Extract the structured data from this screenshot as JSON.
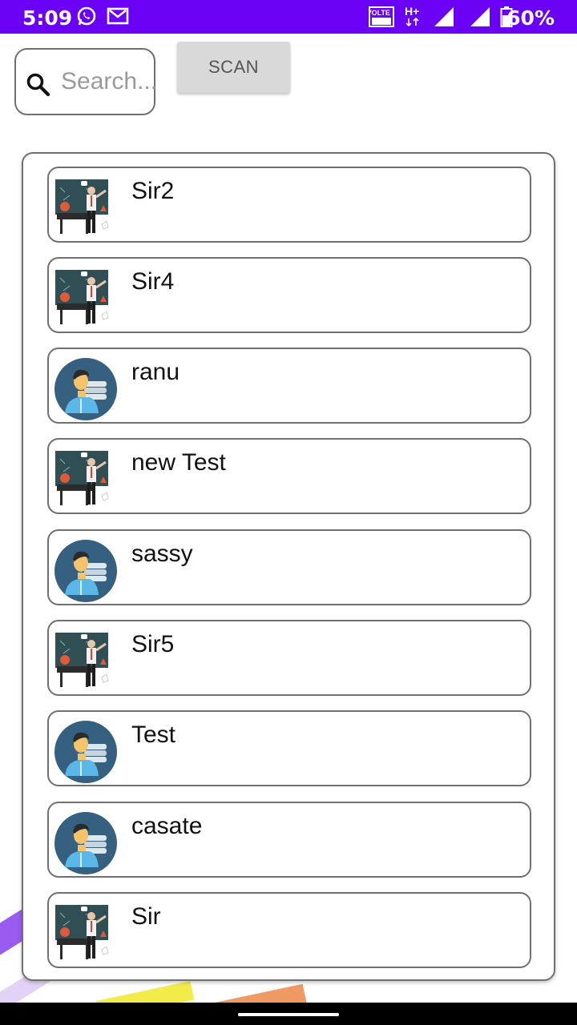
{
  "status_bar": {
    "time": "5:09",
    "battery": "60%",
    "network": "VOLTE 2",
    "data_type": "H+",
    "icons": [
      "whatsapp-icon",
      "gmail-icon",
      "volte-icon",
      "hplus-icon",
      "signal-icon",
      "signal-icon",
      "battery-icon"
    ]
  },
  "search": {
    "placeholder": "Search...",
    "value": ""
  },
  "scan_button": {
    "label": "SCAN"
  },
  "contacts": [
    {
      "name": "Sir2",
      "avatar": "teacher-icon"
    },
    {
      "name": "Sir4",
      "avatar": "teacher-icon"
    },
    {
      "name": "ranu",
      "avatar": "student-icon"
    },
    {
      "name": "new Test",
      "avatar": "teacher-icon"
    },
    {
      "name": "sassy",
      "avatar": "student-icon"
    },
    {
      "name": "Sir5",
      "avatar": "teacher-icon"
    },
    {
      "name": "Test",
      "avatar": "student-icon"
    },
    {
      "name": "casate",
      "avatar": "student-icon"
    },
    {
      "name": "Sir",
      "avatar": "teacher-icon"
    }
  ],
  "colors": {
    "status_bar": "#6a00f4",
    "scan_button": "#d9d9d9",
    "border": "#707070",
    "student_avatar_bg": "#36607f",
    "student_shirt": "#5bb8e6",
    "board": "#2f4f55"
  }
}
